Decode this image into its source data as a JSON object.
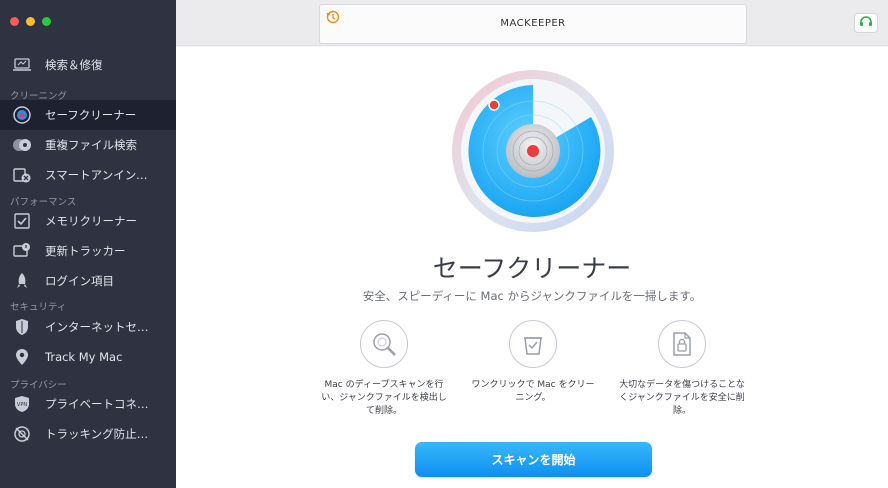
{
  "window": {
    "traffic_lights": [
      "close",
      "minimize",
      "zoom"
    ]
  },
  "sidebar": {
    "items": [
      {
        "label": "検索＆修復",
        "icon": "laptop-icon"
      },
      {
        "label": "セーフクリーナー",
        "icon": "safe-cleaner-icon",
        "active": true
      },
      {
        "label": "重複ファイル検索",
        "icon": "duplicates-icon"
      },
      {
        "label": "スマートアンインス…",
        "icon": "uninstaller-icon"
      },
      {
        "label": "メモリクリーナー",
        "icon": "memory-checklist-icon"
      },
      {
        "label": "更新トラッカー",
        "icon": "update-tracker-icon"
      },
      {
        "label": "ログイン項目",
        "icon": "rocket-icon"
      },
      {
        "label": "インターネットセキュ…",
        "icon": "shield-icon"
      },
      {
        "label": "Track My Mac",
        "icon": "location-pin-icon"
      },
      {
        "label": "プライベートコネクタ",
        "icon": "vpn-shield-icon"
      },
      {
        "label": "トラッキング防止ソフト",
        "icon": "antitracking-icon"
      }
    ],
    "sections": {
      "cleaning": "クリーニング",
      "performance": "パフォーマンス",
      "security": "セキュリティ",
      "privacy": "プライバシー"
    }
  },
  "topbar": {
    "brand": "MACKEEPER"
  },
  "main": {
    "title": "セーフクリーナー",
    "subtitle": "安全、スピーディーに Mac からジャンクファイルを一掃します。",
    "features": [
      {
        "icon": "magnifier-icon",
        "text": "Mac のディープスキャンを行い、ジャンクファイルを検出して削除。"
      },
      {
        "icon": "trash-check-icon",
        "text": "ワンクリックで Mac をクリーニング。"
      },
      {
        "icon": "locked-file-icon",
        "text": "大切なデータを傷つけることなくジャンクファイルを安全に削除。"
      }
    ],
    "scan_button": "スキャンを開始"
  },
  "colors": {
    "accent": "#1a9cf5",
    "sidebar_bg": "#2f3341",
    "active_bg": "#1e2130",
    "radar_dot": "#ef3b3b"
  }
}
